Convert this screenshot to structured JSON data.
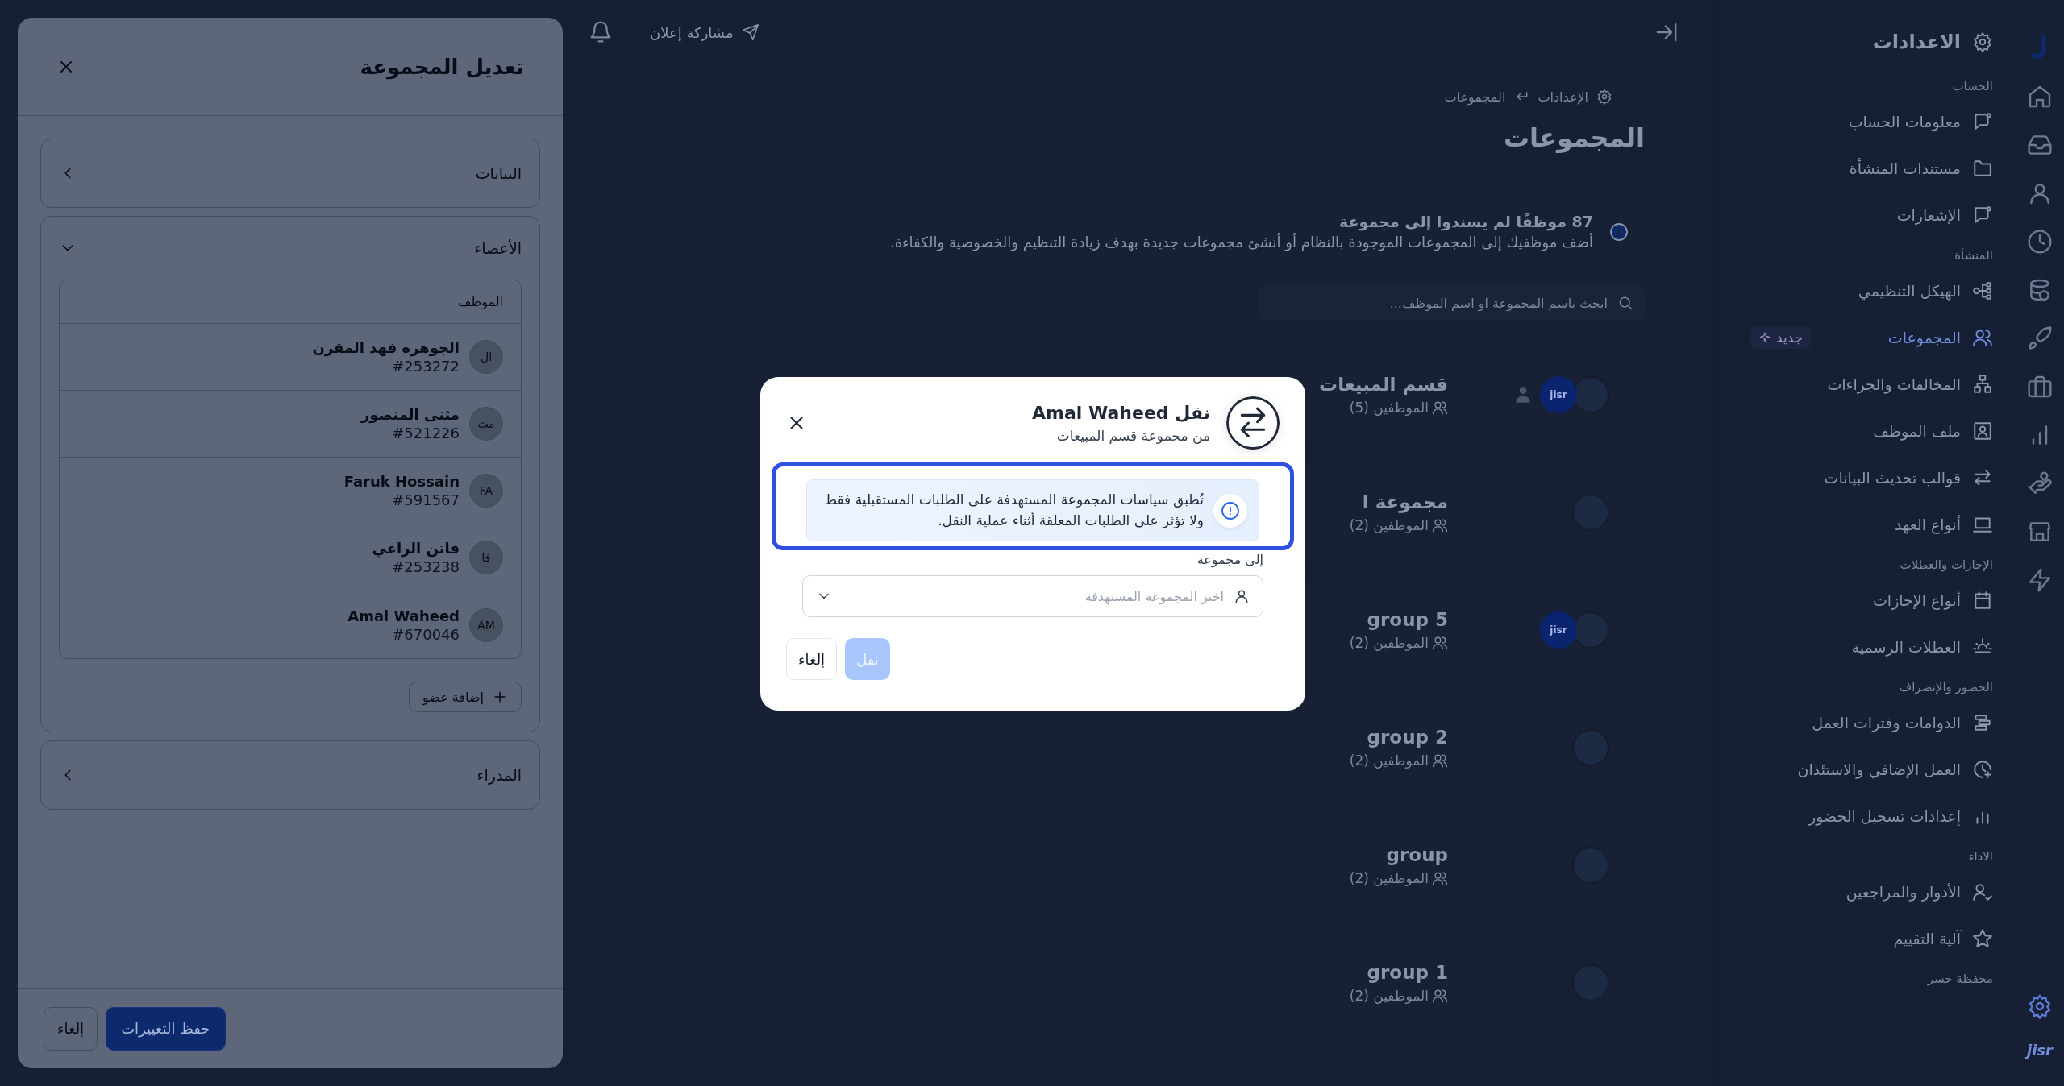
{
  "rail": {
    "brand": "jisr",
    "settings_selected": true
  },
  "sidebar": {
    "title": "الاعدادات",
    "sections": [
      {
        "label": "الحساب",
        "items": [
          {
            "label": "معلومات الحساب",
            "selected": false
          },
          {
            "label": "مستندات المنشأة",
            "selected": false
          },
          {
            "label": "الإشعارات",
            "selected": false
          }
        ]
      },
      {
        "label": "المنشأة",
        "items": [
          {
            "label": "الهيكل التنظيمي",
            "selected": false
          },
          {
            "label": "المجموعات",
            "selected": true,
            "badge": "جديد"
          },
          {
            "label": "المخالفات والجزاءات",
            "selected": false
          },
          {
            "label": "ملف الموظف",
            "selected": false
          },
          {
            "label": "قوالب تحديث البيانات",
            "selected": false
          },
          {
            "label": "أنواع العهد",
            "selected": false
          }
        ]
      },
      {
        "label": "الإجازات والعطلات",
        "items": [
          {
            "label": "أنواع الإجازات",
            "selected": false
          },
          {
            "label": "العطلات الرسمية",
            "selected": false
          }
        ]
      },
      {
        "label": "الحضور والإنصراف",
        "items": [
          {
            "label": "الدوامات وفترات العمل",
            "selected": false
          },
          {
            "label": "العمل الإضافي والاستئذان",
            "selected": false
          },
          {
            "label": "إعدادات تسجيل الحضور",
            "selected": false
          }
        ]
      },
      {
        "label": "الاداء",
        "items": [
          {
            "label": "الأدوار والمراجعين",
            "selected": false
          },
          {
            "label": "آلية التقييم",
            "selected": false
          }
        ]
      },
      {
        "label": "محفظة جسر"
      }
    ]
  },
  "topbar": {
    "announce": "مشاركة إعلان"
  },
  "breadcrumb": [
    "الإعدادات",
    "المجموعات"
  ],
  "page_title": "المجموعات",
  "banner": {
    "title": "87 موظفًا لم يسندوا إلى مجموعة",
    "text": "أضف موظفيك إلى المجموعات الموجودة بالنظام أو أنشئ مجموعات جديدة بهدف زيادة التنظيم والخصوصية والكفاءة."
  },
  "search": {
    "placeholder": "ابحث باسم المجموعة او اسم الموظف..."
  },
  "groups": [
    {
      "name": "قسم المبيعات",
      "count": "الموظفين (5)",
      "avatars": [
        {
          "kind": "photo"
        },
        {
          "kind": "logo",
          "text": "jisr"
        },
        {
          "kind": "person"
        }
      ]
    },
    {
      "name": "مجموعة ا",
      "count": "الموظفين (2)",
      "avatars": [
        {
          "kind": "photo"
        }
      ]
    },
    {
      "name": "group 5",
      "count": "الموظفين (2)",
      "avatars": [
        {
          "kind": "photo"
        },
        {
          "kind": "logo",
          "text": "jisr"
        }
      ]
    },
    {
      "name": "group 2",
      "count": "الموظفين (2)",
      "avatars": [
        {
          "kind": "photo"
        }
      ]
    },
    {
      "name": "group",
      "count": "الموظفين (2)",
      "avatars": [
        {
          "kind": "photo"
        }
      ]
    },
    {
      "name": "group 1",
      "count": "الموظفين (2)",
      "avatars": [
        {
          "kind": "photo"
        }
      ]
    }
  ],
  "drawer": {
    "title": "تعديل المجموعة",
    "sections": [
      {
        "title": "البيانات",
        "expanded": false
      },
      {
        "title": "الأعضاء",
        "expanded": true,
        "column": "الموظف",
        "members": [
          {
            "initials": "ال",
            "name": "الجوهره فهد المقرن",
            "id": "#253272"
          },
          {
            "initials": "مث",
            "name": "مثنى المنصور",
            "id": "#521226"
          },
          {
            "initials": "FA",
            "name": "Faruk Hossain",
            "id": "#591567"
          },
          {
            "initials": "فا",
            "name": "فاتن الراعي",
            "id": "#253238"
          },
          {
            "initials": "AM",
            "name": "Amal Waheed",
            "id": "#670046"
          }
        ],
        "add_button": "إضافة عضو"
      },
      {
        "title": "المدراء",
        "expanded": false
      }
    ],
    "save": "حفظ التغييرات",
    "cancel": "إلغاء"
  },
  "modal": {
    "title": "نقل Amal Waheed",
    "subtitle": "من مجموعة قسم المبيعات",
    "notice": {
      "text": "تُطبق سياسات المجموعة المستهدفة على الطلبات المستقبلية فقط ولا تؤثر على الطلبات المعلقة أثناء عملية النقل.",
      "focused": true
    },
    "field_label": "إلى مجموعة",
    "select": {
      "placeholder": "اختر المجموعة المستهدفة"
    },
    "buttons": [
      {
        "label": "نقل",
        "kind": "primary",
        "disabled": true
      },
      {
        "label": "إلغاء",
        "kind": "secondary",
        "disabled": false
      }
    ]
  }
}
